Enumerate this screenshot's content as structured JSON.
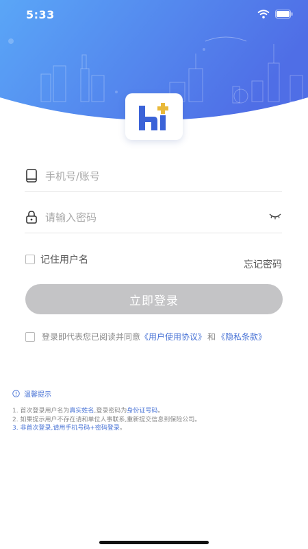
{
  "status": {
    "time": "5:33"
  },
  "form": {
    "account_placeholder": "手机号/账号",
    "password_placeholder": "请输入密码",
    "remember_label": "记住用户名",
    "forgot_label": "忘记密码",
    "login_label": "立即登录"
  },
  "agreement": {
    "prefix": "登录即代表您已阅读并同意",
    "user_agreement": "《用户使用协议》",
    "and": "和",
    "privacy": "《隐私条款》"
  },
  "tips": {
    "title": "温馨提示",
    "item1_prefix": "1. 首次登录用户名为",
    "item1_realname": "真实姓名",
    "item1_mid": ",登录密码为",
    "item1_idcard": "身份证号码",
    "item1_end": "。",
    "item2": "2. 如果提示用户不存在请和单位人事联系,重新提交信息到保险公司。",
    "item3_prefix": "3. ",
    "item3_blue": "非首次登录,请用手机号码+密码登录",
    "item3_end": "。"
  },
  "colors": {
    "hero_gradient_start": "#5aa2f6",
    "hero_gradient_end": "#4f6fe6",
    "link": "#4a74d6",
    "button_disabled": "#c4c4c6",
    "logo_blue": "#3b63d8",
    "logo_gold": "#e9b93a"
  },
  "icons": {
    "phone": "phone-icon",
    "lock": "lock-icon",
    "eye_closed": "eye-closed-icon",
    "info": "info-icon",
    "wifi": "wifi-icon",
    "battery": "battery-icon",
    "signal": "signal-icon"
  }
}
